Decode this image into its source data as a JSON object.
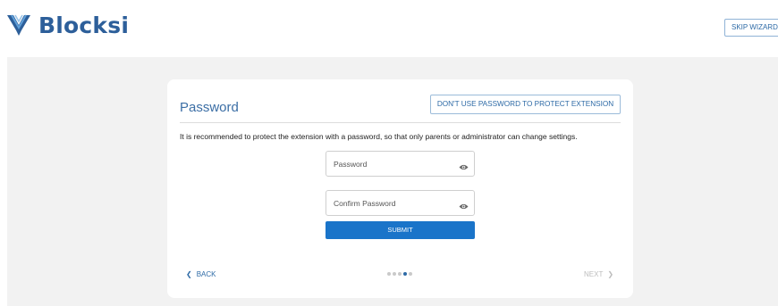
{
  "header": {
    "logo_text": "Blocksi",
    "skip_label": "SKIP WIZARD"
  },
  "card": {
    "title": "Password",
    "no_password_label": "DON'T USE PASSWORD TO PROTECT EXTENSION",
    "description": "It is recommended to protect the extension with a password, so that only parents or administrator can change settings.",
    "password_placeholder": "Password",
    "confirm_placeholder": "Confirm Password",
    "submit_label": "SUBMIT"
  },
  "footer": {
    "back_label": "BACK",
    "next_label": "NEXT",
    "steps_total": 5,
    "current_step": 4
  },
  "colors": {
    "brand": "#2d5f9a",
    "accent": "#1a74c9",
    "background": "#f2f2f2"
  },
  "icons": [
    "blocksi-logo",
    "eye-icon",
    "chevron-left-icon",
    "chevron-right-icon"
  ]
}
